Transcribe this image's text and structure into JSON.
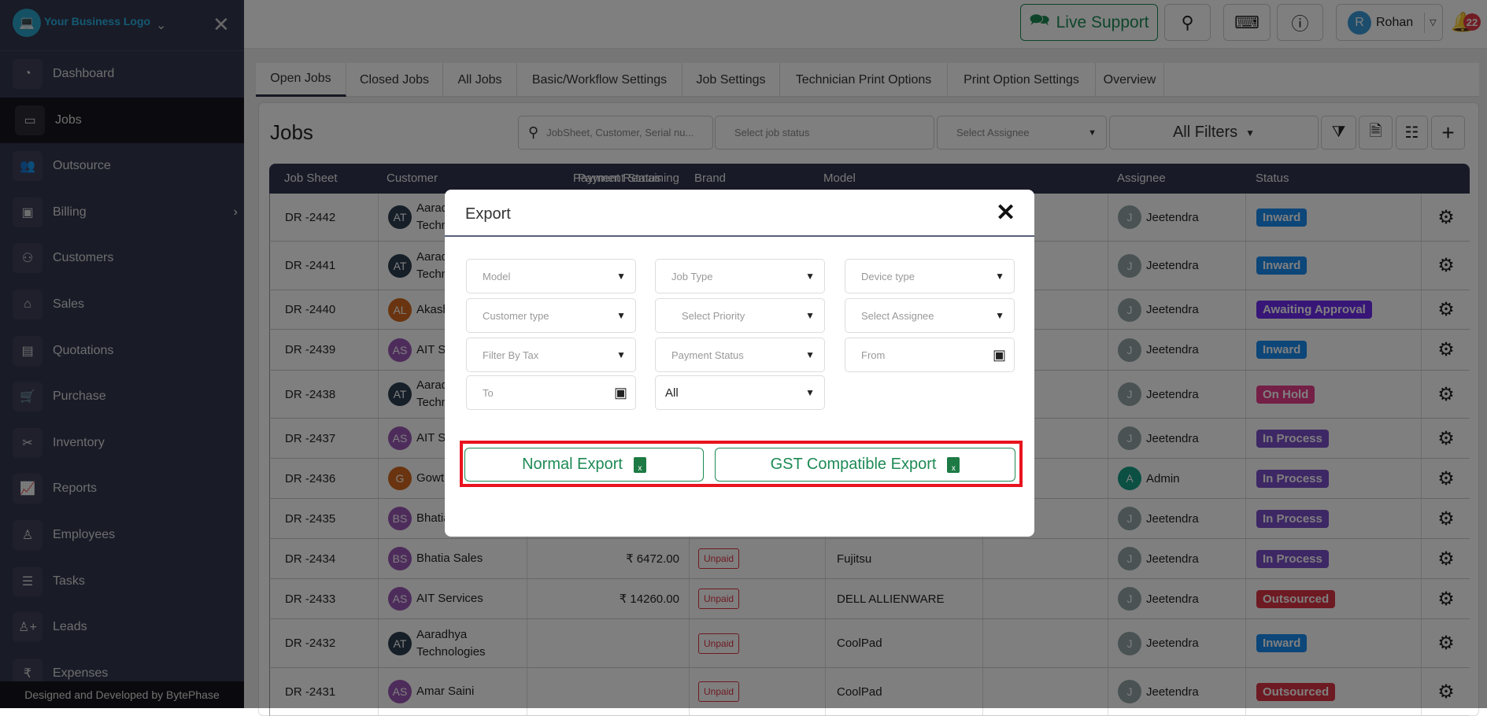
{
  "sidebar": {
    "logo_text": "Your Business Logo",
    "items": [
      {
        "label": "Dashboard",
        "icon": "◔"
      },
      {
        "label": "Jobs",
        "icon": "▭",
        "active": true
      },
      {
        "label": "Outsource",
        "icon": "👥"
      },
      {
        "label": "Billing",
        "icon": "▣",
        "has_submenu": true
      },
      {
        "label": "Customers",
        "icon": "⚇"
      },
      {
        "label": "Sales",
        "icon": "⌂"
      },
      {
        "label": "Quotations",
        "icon": "▤"
      },
      {
        "label": "Purchase",
        "icon": "🛒"
      },
      {
        "label": "Inventory",
        "icon": "✂"
      },
      {
        "label": "Reports",
        "icon": "📈"
      },
      {
        "label": "Employees",
        "icon": "♙"
      },
      {
        "label": "Tasks",
        "icon": "☰"
      },
      {
        "label": "Leads",
        "icon": "♙+"
      },
      {
        "label": "Expenses",
        "icon": "₹"
      }
    ],
    "footer": "Designed and Developed by BytePhase"
  },
  "topbar": {
    "live_support": "Live Support",
    "user_initial": "R",
    "user_name": "Rohan",
    "notification_count": "22"
  },
  "tabs": [
    "Open Jobs",
    "Closed Jobs",
    "All Jobs",
    "Basic/Workflow Settings",
    "Job Settings",
    "Technician Print Options",
    "Print Option Settings",
    "Overview"
  ],
  "jobs": {
    "title": "Jobs",
    "search_placeholder": "JobSheet, Customer, Serial nu...",
    "status_placeholder": "Select job status",
    "assignee_placeholder": "Select Assignee",
    "all_filters": "All Filters"
  },
  "table": {
    "columns": [
      "Job Sheet",
      "Customer",
      "Payment Remaining",
      "Payment Status",
      "Brand",
      "Model",
      "Assignee",
      "Status"
    ],
    "rows": [
      {
        "job": "DR -2442",
        "initials": "AT",
        "customer": "Aaradhya Technologies",
        "av": "#2c3e50",
        "amount": "",
        "pay": "",
        "brand": "",
        "assignee_initial": "J",
        "assignee": "Jeetendra",
        "aav": "#95a5a6",
        "status": "Inward",
        "sc": "#1a8cf0"
      },
      {
        "job": "DR -2441",
        "initials": "AT",
        "customer": "Aaradhya Technologies",
        "av": "#2c3e50",
        "amount": "",
        "pay": "",
        "brand": "",
        "assignee_initial": "J",
        "assignee": "Jeetendra",
        "aav": "#95a5a6",
        "status": "Inward",
        "sc": "#1a8cf0"
      },
      {
        "job": "DR -2440",
        "initials": "AL",
        "customer": "Akash",
        "av": "#d2691e",
        "amount": "",
        "pay": "",
        "brand": "",
        "assignee_initial": "J",
        "assignee": "Jeetendra",
        "aav": "#95a5a6",
        "status": "Awaiting Approval",
        "sc": "#6f2cf0"
      },
      {
        "job": "DR -2439",
        "initials": "AS",
        "customer": "AIT Services",
        "av": "#9b59b6",
        "amount": "",
        "pay": "",
        "brand": "",
        "assignee_initial": "J",
        "assignee": "Jeetendra",
        "aav": "#95a5a6",
        "status": "Inward",
        "sc": "#1a8cf0"
      },
      {
        "job": "DR -2438",
        "initials": "AT",
        "customer": "Aaradhya Technologies",
        "av": "#2c3e50",
        "amount": "",
        "pay": "",
        "brand": "",
        "assignee_initial": "J",
        "assignee": "Jeetendra",
        "aav": "#95a5a6",
        "status": "On Hold",
        "sc": "#e83e8c"
      },
      {
        "job": "DR -2437",
        "initials": "AS",
        "customer": "AIT Services",
        "av": "#9b59b6",
        "amount": "",
        "pay": "",
        "brand": "",
        "assignee_initial": "J",
        "assignee": "Jeetendra",
        "aav": "#95a5a6",
        "status": "In Process",
        "sc": "#7a4fc9"
      },
      {
        "job": "DR -2436",
        "initials": "G",
        "customer": "Gowth",
        "av": "#d2691e",
        "amount": "",
        "pay": "",
        "brand": "",
        "assignee_initial": "A",
        "assignee": "Admin",
        "aav": "#16a085",
        "status": "In Process",
        "sc": "#7a4fc9"
      },
      {
        "job": "DR -2435",
        "initials": "BS",
        "customer": "Bhatia Sales",
        "av": "#9b59b6",
        "amount": "",
        "pay": "",
        "brand": "",
        "assignee_initial": "J",
        "assignee": "Jeetendra",
        "aav": "#95a5a6",
        "status": "In Process",
        "sc": "#7a4fc9"
      },
      {
        "job": "DR -2434",
        "initials": "BS",
        "customer": "Bhatia Sales",
        "av": "#9b59b6",
        "amount": "₹ 6472.00",
        "pay": "Unpaid",
        "brand": "Fujitsu",
        "assignee_initial": "J",
        "assignee": "Jeetendra",
        "aav": "#95a5a6",
        "status": "In Process",
        "sc": "#7a4fc9"
      },
      {
        "job": "DR -2433",
        "initials": "AS",
        "customer": "AIT Services",
        "av": "#9b59b6",
        "amount": "₹ 14260.00",
        "pay": "Unpaid",
        "brand": "DELL ALLIENWARE",
        "assignee_initial": "J",
        "assignee": "Jeetendra",
        "aav": "#95a5a6",
        "status": "Outsourced",
        "sc": "#dc3545"
      },
      {
        "job": "DR -2432",
        "initials": "AT",
        "customer": "Aaradhya Technologies",
        "av": "#2c3e50",
        "amount": "",
        "pay": "Unpaid",
        "brand": "CoolPad",
        "assignee_initial": "J",
        "assignee": "Jeetendra",
        "aav": "#95a5a6",
        "status": "Inward",
        "sc": "#1a8cf0"
      },
      {
        "job": "DR -2431",
        "initials": "AS",
        "customer": "Amar Saini",
        "av": "#9b59b6",
        "amount": "",
        "pay": "Unpaid",
        "brand": "CoolPad",
        "assignee_initial": "J",
        "assignee": "Jeetendra",
        "aav": "#95a5a6",
        "status": "Outsourced",
        "sc": "#dc3545"
      }
    ]
  },
  "modal": {
    "title": "Export",
    "fields": [
      {
        "label": "Model",
        "kind": "select"
      },
      {
        "label": "Job Type",
        "kind": "select"
      },
      {
        "label": "Device type",
        "kind": "select"
      },
      {
        "label": "Customer type",
        "kind": "select"
      },
      {
        "label": "Select Priority",
        "kind": "select"
      },
      {
        "label": "Select Assignee",
        "kind": "select"
      },
      {
        "label": "Filter By Tax",
        "kind": "select"
      },
      {
        "label": "Payment Status",
        "kind": "select"
      },
      {
        "label": "From",
        "kind": "date"
      },
      {
        "label": "To",
        "kind": "date"
      },
      {
        "label": "All",
        "kind": "select",
        "value": true
      }
    ],
    "normal_export": "Normal Export",
    "gst_export": "GST Compatible Export",
    "excel_icon_letter": "x"
  },
  "colors": {
    "accent_green": "#1d8a55",
    "highlight_red": "#e8141f"
  }
}
